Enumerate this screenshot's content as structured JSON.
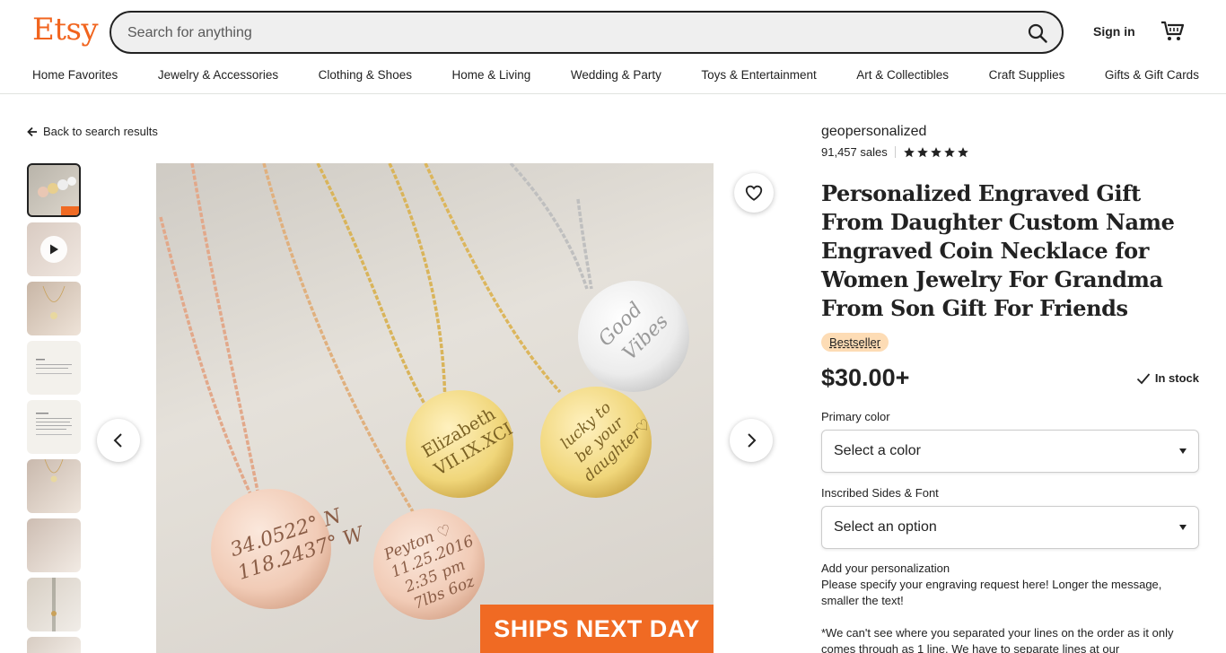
{
  "header": {
    "logo": "Etsy",
    "search_placeholder": "Search for anything",
    "sign_in": "Sign in"
  },
  "nav": [
    "Home Favorites",
    "Jewelry & Accessories",
    "Clothing & Shoes",
    "Home & Living",
    "Wedding & Party",
    "Toys & Entertainment",
    "Art & Collectibles",
    "Craft Supplies",
    "Gifts & Gift Cards"
  ],
  "back_link": "Back to search results",
  "gallery": {
    "banner": "SHIPS NEXT DAY",
    "engravings": {
      "coin1": [
        "34.0522° N",
        "118.2437° W"
      ],
      "coin2": [
        "Peyton ♡",
        "11.25.2016",
        "2:35 pm",
        "7lbs 6oz"
      ],
      "coin3": [
        "Elizabeth",
        "VII.IX.XCI"
      ],
      "coin4": [
        "lucky to",
        "be your",
        "daughter♡"
      ],
      "coin5": [
        "Good",
        "Vibes"
      ]
    }
  },
  "listing": {
    "shop": "geopersonalized",
    "sales": "91,457 sales",
    "rating": 5,
    "title": "Personalized Engraved Gift From Daughter Custom Name Engraved Coin Necklace for Women Jewelry For Grandma From Son Gift For Friends",
    "badge": "Bestseller",
    "price": "$30.00+",
    "stock": "In stock",
    "color_label": "Primary color",
    "color_value": "Select a color",
    "sides_label": "Inscribed Sides & Font",
    "sides_value": "Select an option",
    "personalization_label": "Add your personalization",
    "personalization_text": "Please specify your engraving request here! Longer the message, smaller the text!",
    "note_text": "*We can't see where you separated your lines on the order as it only comes through as 1 line. We have to separate lines at our"
  },
  "colors": {
    "brand": "#f1641e",
    "banner": "#f06a23",
    "badge": "#fddcb5"
  }
}
